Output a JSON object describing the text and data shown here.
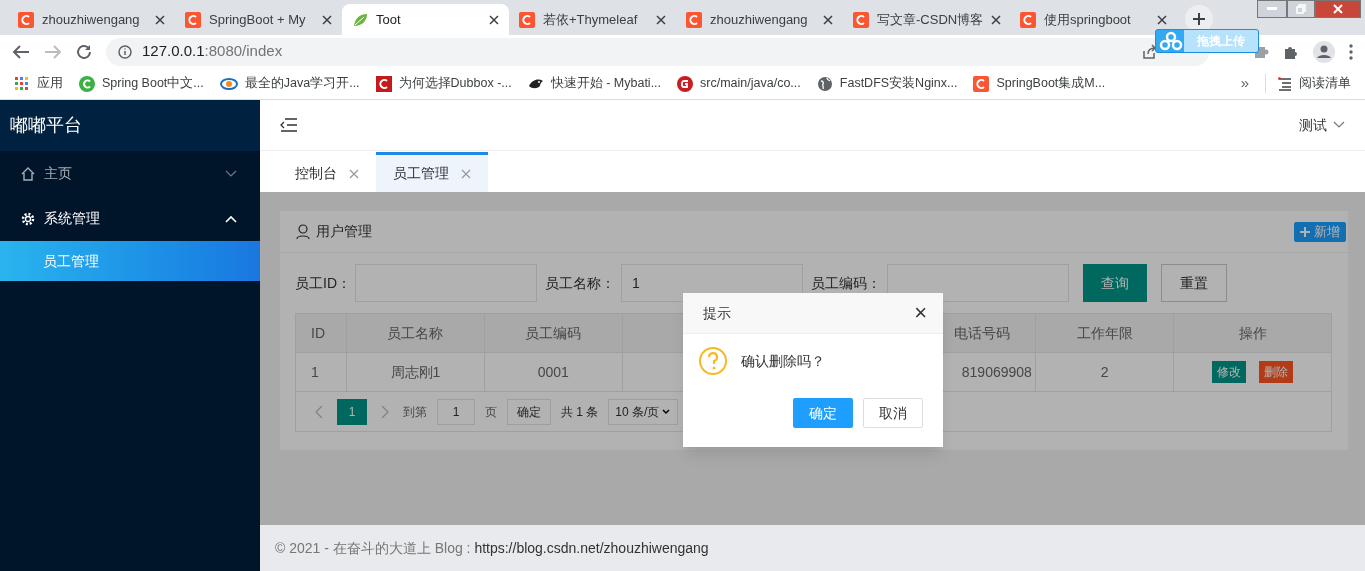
{
  "browser": {
    "tabs": [
      {
        "title": "zhouzhiwengang",
        "kind": "csdn",
        "selected": false
      },
      {
        "title": "SpringBoot + My",
        "kind": "csdn",
        "selected": false
      },
      {
        "title": "Toot",
        "kind": "leaf",
        "selected": true
      },
      {
        "title": "若依+Thymeleaf",
        "kind": "csdn",
        "selected": false
      },
      {
        "title": "zhouzhiwengang",
        "kind": "csdn",
        "selected": false
      },
      {
        "title": "写文章-CSDN博客",
        "kind": "csdn",
        "selected": false
      },
      {
        "title": "使用springboot",
        "kind": "csdn",
        "selected": false
      }
    ],
    "url_host": "127.0.0.1",
    "url_rest": ":8080/index",
    "upload_widget": "拖拽上传",
    "bookmarks": [
      {
        "label": "应用",
        "kind": "apps"
      },
      {
        "label": "Spring Boot中文...",
        "kind": "green"
      },
      {
        "label": "最全的Java学习开...",
        "kind": "pn"
      },
      {
        "label": "为何选择Dubbox -...",
        "kind": "csdn-dark"
      },
      {
        "label": "快速开始 - Mybati...",
        "kind": "bird"
      },
      {
        "label": "src/main/java/co...",
        "kind": "gitee"
      },
      {
        "label": "FastDFS安装Nginx...",
        "kind": "globe"
      },
      {
        "label": "SpringBoot集成M...",
        "kind": "csdn"
      }
    ],
    "more": "»",
    "reading_list": "阅读清单"
  },
  "app": {
    "logo": "嘟嘟平台",
    "menu": [
      {
        "label": "主页",
        "kind": "home",
        "expanded": false
      },
      {
        "label": "系统管理",
        "kind": "gear",
        "expanded": true,
        "children": [
          {
            "label": "员工管理",
            "selected": true
          }
        ]
      }
    ],
    "user": "测试",
    "page_tabs": [
      {
        "label": "控制台",
        "selected": false
      },
      {
        "label": "员工管理",
        "selected": true
      }
    ],
    "card_title": "用户管理",
    "add_button": "新增",
    "filters": [
      {
        "label": "员工ID："
      },
      {
        "label": "员工名称：",
        "value": "1"
      },
      {
        "label": "员工编码："
      }
    ],
    "search_button": "查询",
    "reset_button": "重置",
    "table": {
      "columns": [
        "ID",
        "员工名称",
        "员工编码",
        "电话号码",
        "工作年限",
        "操作"
      ],
      "rows": [
        {
          "cells": [
            "1",
            "周志刚1",
            "0001",
            "819069908",
            "2"
          ],
          "actions": [
            "修改",
            "删除"
          ]
        }
      ]
    },
    "pagination": {
      "page": "1",
      "goto_label": "到第",
      "goto_value": "1",
      "page_label": "页",
      "confirm": "确定",
      "total": "共 1 条",
      "page_size": "10 条/页"
    },
    "dialog": {
      "title": "提示",
      "close": "×",
      "message": "确认删除吗？",
      "ok": "确定",
      "cancel": "取消"
    },
    "footer_text": "© 2021 - 在奋斗的大道上 Blog : ",
    "footer_link": "https://blog.csdn.net/zhouzhiwengang"
  }
}
